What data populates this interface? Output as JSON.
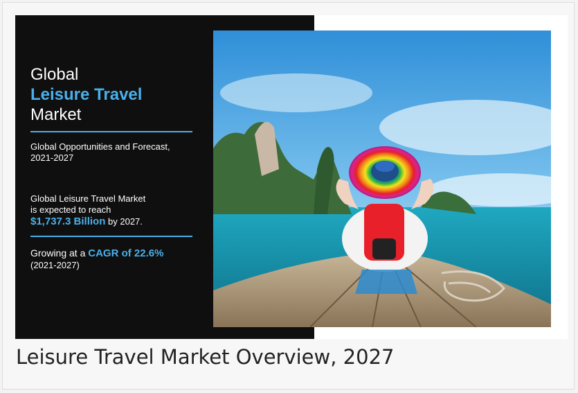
{
  "infographic": {
    "title": {
      "line1": "Global",
      "line2": "Leisure Travel",
      "line3": "Market"
    },
    "subtitle": {
      "line1": "Global Opportunities and Forecast,",
      "line2": "2021-2027"
    },
    "expectation": {
      "line1": "Global Leisure Travel Market",
      "line2": "is expected to reach",
      "value": "$1,737.3 Billion",
      "suffix": "by 2027."
    },
    "growth": {
      "prefix": "Growing at a",
      "value": "CAGR of 22.6%",
      "period": "(2021-2027)"
    },
    "photo_icon": "woman-on-boat-photo"
  },
  "caption": "Leisure Travel Market Overview, 2027",
  "colors": {
    "accent": "#4ab0ea",
    "panel": "#0f0f10",
    "caption_text": "#222222"
  }
}
